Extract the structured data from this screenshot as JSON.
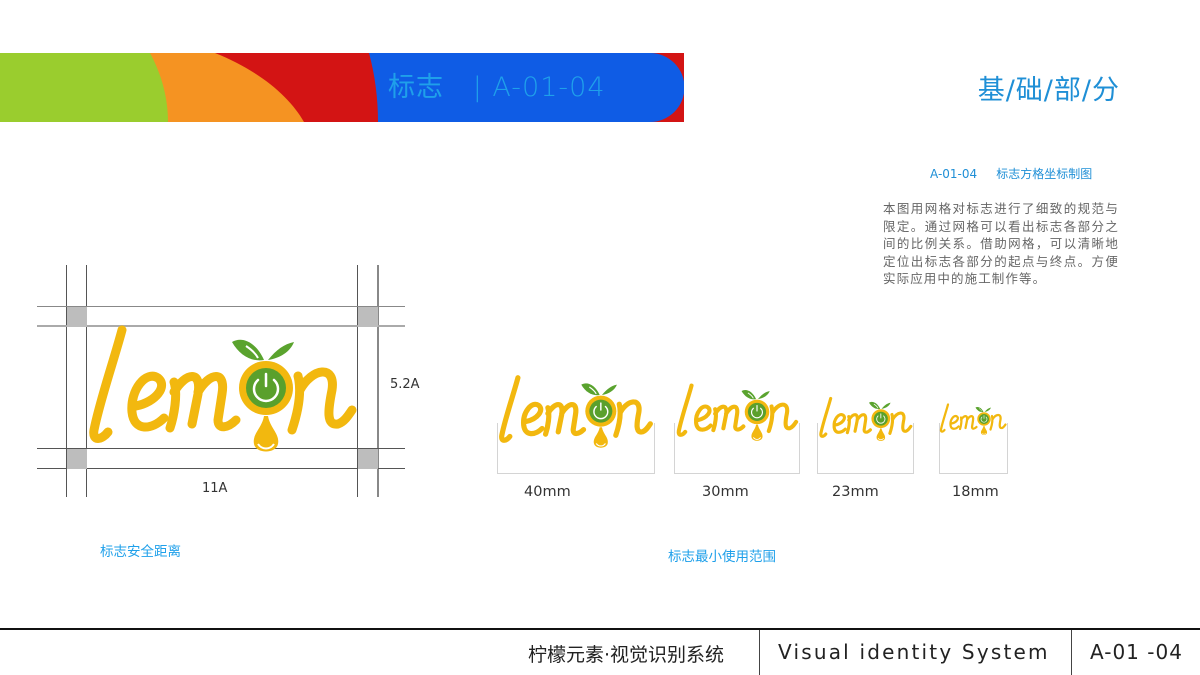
{
  "header": {
    "title": "标志   | A-01-04",
    "section": "基/础/部/分",
    "colors": {
      "green": "#9acd2e",
      "orange": "#f59322",
      "red": "#d31414",
      "blue": "#0f5ce5",
      "title_text": "#1fa0ea"
    }
  },
  "description": {
    "heading": "A-01-04     标志方格坐标制图",
    "body": "本图用网格对标志进行了细致的规范与限定。通过网格可以看出标志各部分之间的比例关系。借助网格，可以清晰地定位出标志各部分的起点与终点。方便实际应用中的施工制作等。"
  },
  "safe_area": {
    "logo_text": "lemon",
    "height_label": "5.2A",
    "width_label": "11A",
    "caption": "标志安全距离"
  },
  "min_size": {
    "caption": "标志最小使用范围",
    "items": [
      {
        "label": "40mm",
        "logo_text": "lemon"
      },
      {
        "label": "30mm",
        "logo_text": "lemon"
      },
      {
        "label": "23mm",
        "logo_text": "lemon"
      },
      {
        "label": "18mm",
        "logo_text": "lemon"
      }
    ]
  },
  "logo_colors": {
    "yellow": "#f2b80f",
    "green": "#5aa02c",
    "leaf": "#5aa32e"
  },
  "footer": {
    "cn": "柠檬元素·视觉识别系统",
    "en": "Visual identity System",
    "code": "A-01 -04"
  }
}
